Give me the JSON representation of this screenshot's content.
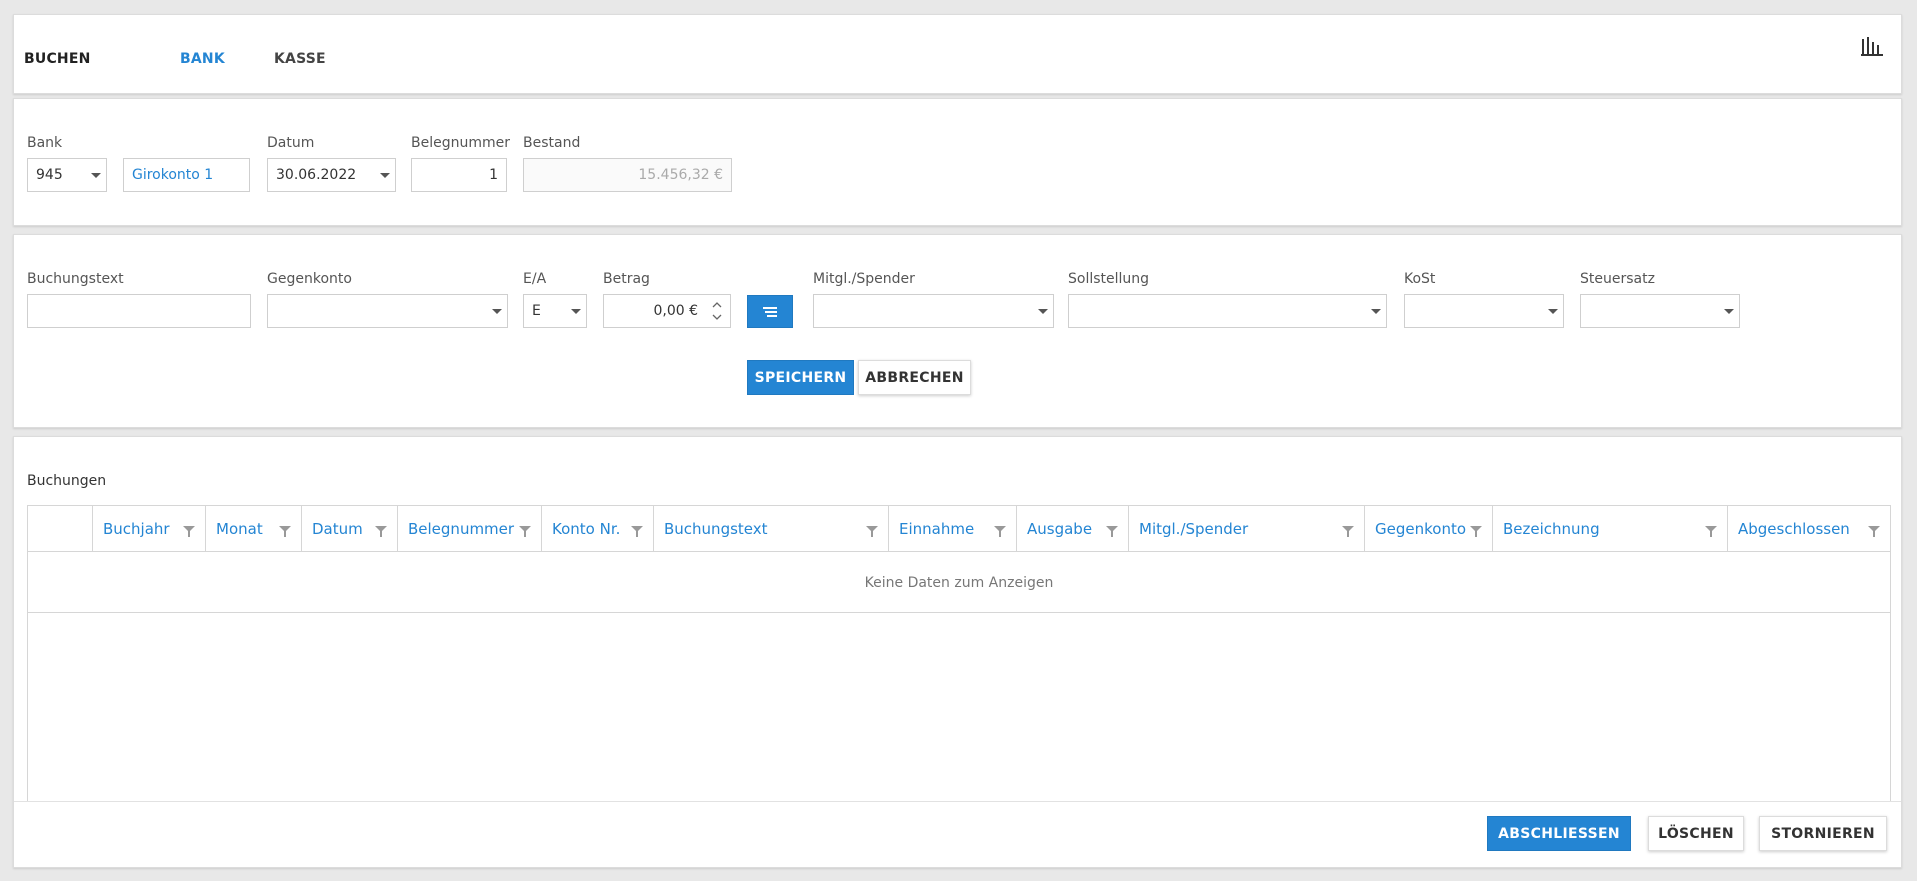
{
  "nav": {
    "title": "BUCHEN",
    "tabs": [
      {
        "label": "BANK",
        "active": true
      },
      {
        "label": "KASSE",
        "active": false
      }
    ],
    "chart_icon": "bar-chart-icon"
  },
  "bank_panel": {
    "bank": {
      "label": "Bank",
      "value": "945"
    },
    "account_name": "Girokonto 1",
    "date": {
      "label": "Datum",
      "value": "30.06.2022"
    },
    "voucher": {
      "label": "Belegnummer",
      "value": "1"
    },
    "balance": {
      "label": "Bestand",
      "value": "15.456,32 €"
    }
  },
  "booking_form": {
    "text": {
      "label": "Buchungstext",
      "value": ""
    },
    "counter_account": {
      "label": "Gegenkonto",
      "value": ""
    },
    "ea": {
      "label": "E/A",
      "value": "E"
    },
    "amount": {
      "label": "Betrag",
      "value": "0,00 €"
    },
    "member": {
      "label": "Mitgl./Spender",
      "value": ""
    },
    "target": {
      "label": "Sollstellung",
      "value": ""
    },
    "cost_center": {
      "label": "KoSt",
      "value": ""
    },
    "tax": {
      "label": "Steuersatz",
      "value": ""
    },
    "save_label": "SPEICHERN",
    "cancel_label": "ABBRECHEN"
  },
  "bookings": {
    "title": "Buchungen",
    "columns": [
      "Buchjahr",
      "Monat",
      "Datum",
      "Belegnummer",
      "Konto Nr.",
      "Buchungstext",
      "Einnahme",
      "Ausgabe",
      "Mitgl./Spender",
      "Gegenkonto",
      "Bezeichnung",
      "Abgeschlossen"
    ],
    "empty_text": "Keine Daten zum Anzeigen"
  },
  "footer": {
    "close_label": "ABSCHLIESSEN",
    "delete_label": "LÖSCHEN",
    "cancel_label": "STORNIEREN"
  },
  "colors": {
    "accent": "#2485d3",
    "background": "#e8e8e8"
  }
}
